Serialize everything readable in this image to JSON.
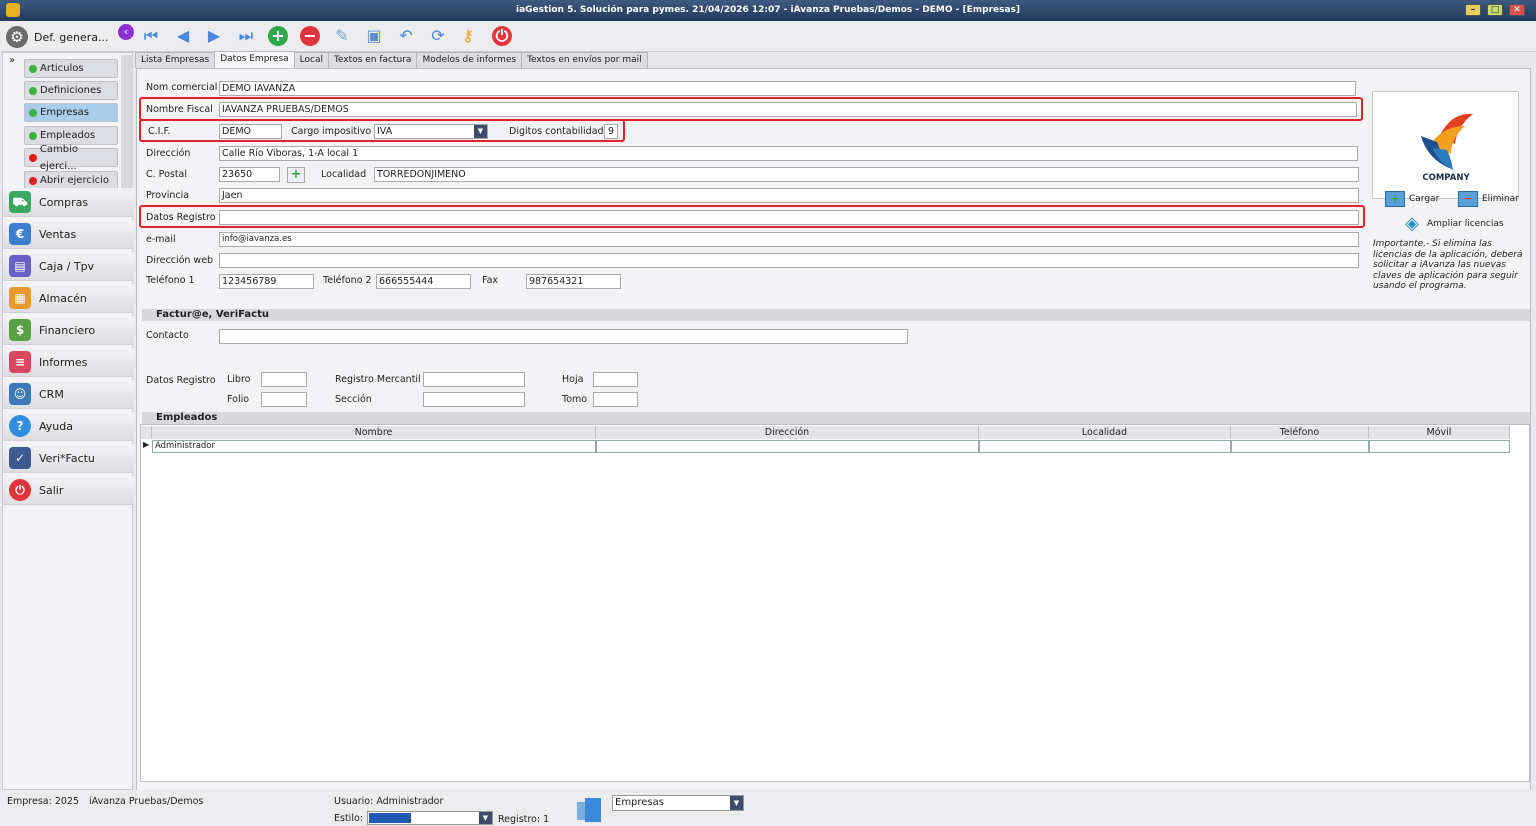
{
  "window": {
    "title": "iaGestion 5. Solución para pymes.  21/04/2026 12:07  -  iAvanza Pruebas/Demos - DEMO - [Empresas]"
  },
  "toolbar": {
    "def_general_label": "Def. genera..."
  },
  "sidebar": {
    "sub_items": [
      {
        "label": "Articulos",
        "status": "green"
      },
      {
        "label": "Definiciones",
        "status": "green"
      },
      {
        "label": "Empresas",
        "status": "green"
      },
      {
        "label": "Empleados",
        "status": "green"
      },
      {
        "label": "Cambio ejerci...",
        "status": "red"
      },
      {
        "label": "Abrir ejercicio",
        "status": "red"
      }
    ],
    "items": [
      {
        "label": "Compras"
      },
      {
        "label": "Ventas"
      },
      {
        "label": "Caja / Tpv"
      },
      {
        "label": "Almacén"
      },
      {
        "label": "Financiero"
      },
      {
        "label": "Informes"
      },
      {
        "label": "CRM"
      },
      {
        "label": "Ayuda"
      },
      {
        "label": "Veri*Factu"
      },
      {
        "label": "Salir"
      }
    ]
  },
  "tabs": [
    {
      "label": "Lista Empresas"
    },
    {
      "label": "Datos Empresa"
    },
    {
      "label": "Local"
    },
    {
      "label": "Textos en factura"
    },
    {
      "label": "Modelos de informes"
    },
    {
      "label": "Textos en envíos por mail"
    }
  ],
  "form": {
    "nom_comercial": {
      "label": "Nom comercial",
      "value": "DEMO IAVANZA"
    },
    "nombre_fiscal": {
      "label": "Nombre Fiscal",
      "value": "IAVANZA PRUEBAS/DEMOS"
    },
    "cif": {
      "label": "C.I.F.",
      "value": "DEMO"
    },
    "cargo": {
      "label": "Cargo impositivo",
      "value": "IVA"
    },
    "digitos": {
      "label": "Digitos contabilidad",
      "value": "9"
    },
    "direccion": {
      "label": "Dirección",
      "value": "Calle Río Viboras, 1-A local 1"
    },
    "cpostal": {
      "label": "C. Postal",
      "value": "23650"
    },
    "localidad": {
      "label": "Localidad",
      "value": "TORREDONJIMENO"
    },
    "provincia": {
      "label": "Provincia",
      "value": "Jaen"
    },
    "datos_registro": {
      "label": "Datos Registro",
      "value": ""
    },
    "email": {
      "label": "e-mail",
      "value": "info@iavanza.es"
    },
    "web": {
      "label": "Dirección web",
      "value": ""
    },
    "tel1": {
      "label": "Teléfono 1",
      "value": "123456789"
    },
    "tel2": {
      "label": "Teléfono 2",
      "value": "666555444"
    },
    "fax": {
      "label": "Fax",
      "value": "987654321"
    }
  },
  "logo_panel": {
    "company_text": "COMPANY",
    "cargar": "Cargar",
    "eliminar": "Eliminar",
    "ampliar": "Ampliar licencias",
    "note": "Importante.- Si elimina las licencias de la aplicación, deberá solicitar a iAvanza las nuevas claves de aplicación para seguir usando el programa."
  },
  "facturae": {
    "title": "Factur@e, VeriFactu",
    "contacto_label": "Contacto",
    "datos_registro_label": "Datos Registro",
    "libro": "Libro",
    "folio": "Folio",
    "registro_mercantil": "Registro Mercantil",
    "seccion": "Sección",
    "hoja": "Hoja",
    "tomo": "Tomo"
  },
  "empleados": {
    "title": "Empleados",
    "columns": [
      "Nombre",
      "Dirección",
      "Localidad",
      "Teléfono",
      "Móvil"
    ],
    "rows": [
      [
        "Administrador",
        "",
        "",
        "",
        ""
      ]
    ]
  },
  "status": {
    "empresa": "Empresa:  2025",
    "empresa_name": "iAvanza Pruebas/Demos",
    "usuario": "Usuario: Administrador",
    "estilo": "Estilo:",
    "registro": "Registro:  1",
    "module": "Empresas"
  }
}
